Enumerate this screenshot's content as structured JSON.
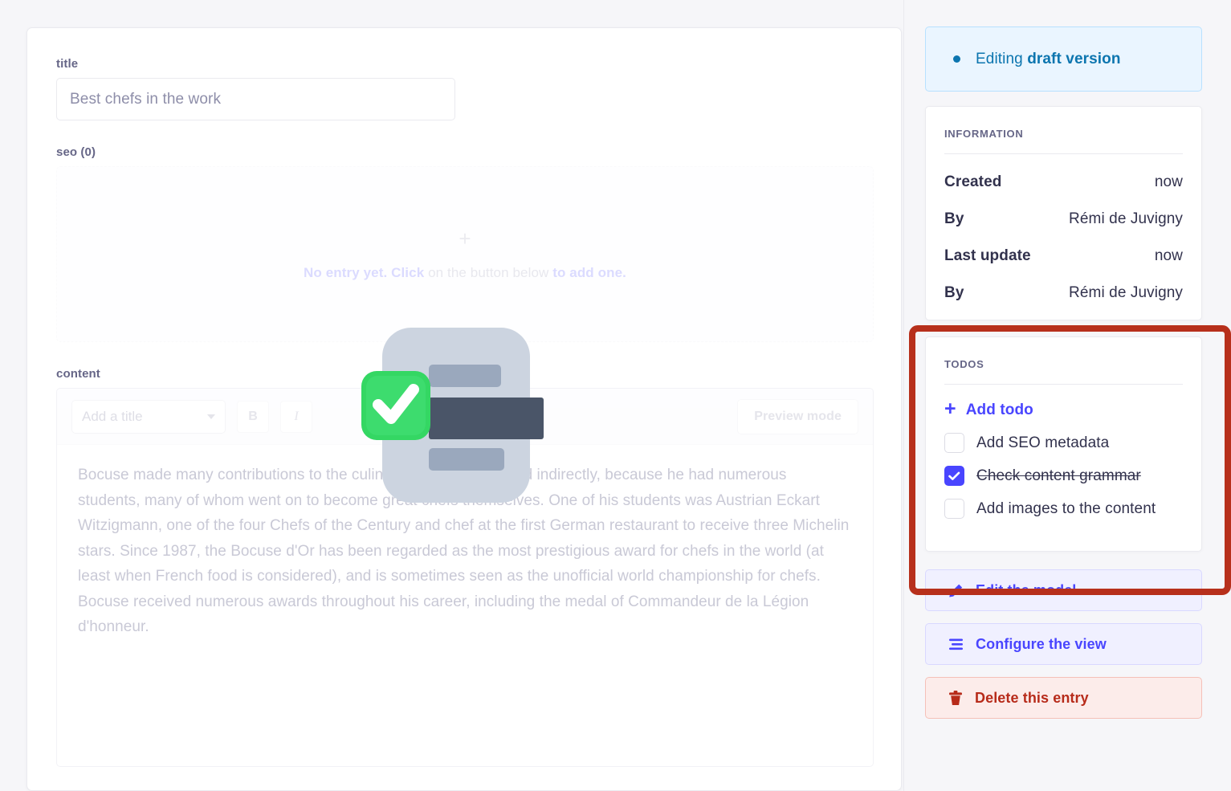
{
  "main": {
    "title_field": {
      "label": "title",
      "value": "Best chefs in the work",
      "placeholder": "Best chefs in the work"
    },
    "seo_field": {
      "label": "seo (0)",
      "empty_prefix": "No entry yet. Click",
      "empty_middle": "on the button below",
      "empty_suffix": "to add one.",
      "add_link": "add one.",
      "plus_icon": "plus-icon"
    },
    "content_field": {
      "label": "content",
      "toolbar": {
        "title_select_value": "Add a title",
        "bold_label": "B",
        "italic_label": "I",
        "preview_button": "Preview mode"
      },
      "body": "Bocuse made many contributions to the culinary world, directly and indirectly, because he had numerous students, many of whom went on to become great chefs themselves. One of his students was Austrian Eckart Witzigmann, one of the four Chefs of the Century and chef at the first German restaurant to receive three Michelin stars. Since 1987, the Bocuse d'Or has been regarded as the most prestigious award for chefs in the world (at least when French food is considered), and is sometimes seen as the unofficial world championship for chefs. Bocuse received numerous awards throughout his career, including the medal of Commandeur de la Légion d'honneur."
    },
    "overlay_illustration": "document-with-check-illustration"
  },
  "sidebar": {
    "draft_banner": {
      "dot_icon": "status-dot-icon",
      "prefix": "Editing ",
      "emphasis": "draft version"
    },
    "information": {
      "title": "INFORMATION",
      "rows": [
        {
          "key": "Created",
          "value": "now"
        },
        {
          "key": "By",
          "value": "Rémi de Juvigny"
        },
        {
          "key": "Last update",
          "value": "now"
        },
        {
          "key": "By",
          "value": "Rémi de Juvigny"
        }
      ]
    },
    "todos": {
      "title": "TODOS",
      "add_label": "Add todo",
      "add_icon": "plus-icon",
      "items": [
        {
          "label": "Add SEO metadata",
          "checked": false
        },
        {
          "label": "Check content grammar",
          "checked": true
        },
        {
          "label": "Add images to the content",
          "checked": false
        }
      ],
      "highlight_color": "#b7301c"
    },
    "actions": [
      {
        "label": "Edit the model",
        "icon": "pencil-icon",
        "style": "primary"
      },
      {
        "label": "Configure the view",
        "icon": "sliders-icon",
        "style": "primary"
      },
      {
        "label": "Delete this entry",
        "icon": "trash-icon",
        "style": "danger"
      }
    ]
  },
  "colors": {
    "accent": "#4945ff",
    "danger": "#b72b1a",
    "draft_blue": "#0c75af",
    "page_bg": "#f6f6f9",
    "check_green": "#32cd64"
  }
}
